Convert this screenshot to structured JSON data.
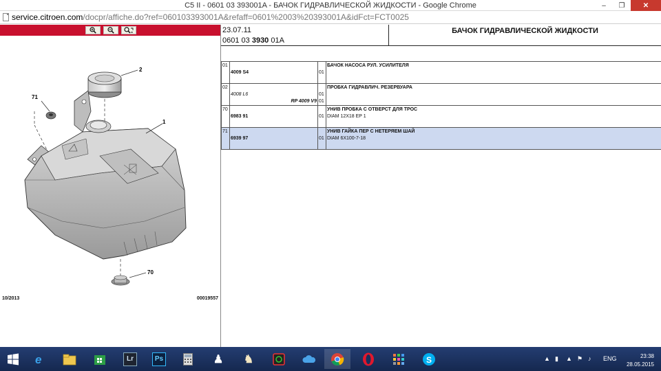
{
  "window": {
    "title": "C5 II - 0601 03 393001A - БАЧОК ГИДРАВЛИЧЕСКОЙ ЖИДКОСТИ - Google Chrome",
    "url_host": "service.citroen.com",
    "url_path": "/docpr/affiche.do?ref=060103393001A&refaff=0601%2003%20393001A&idFct=FCT0025"
  },
  "left_panel": {
    "toolbar": {
      "zoom_in_icon": "zoom-in",
      "zoom_out_icon": "zoom-out",
      "zoom_fit_icon": "zoom-fit",
      "bar_color": "#c8102e"
    },
    "callouts": {
      "c1": "1",
      "c2": "2",
      "c70": "70",
      "c71": "71"
    },
    "footer_date": "10/2013",
    "footer_code": "00019557"
  },
  "header": {
    "date": "23.07.11",
    "ref_prefix": "0601 03",
    "ref_bold": "3930",
    "ref_suffix": "01A",
    "title": "БАЧОК ГИДРАВЛИЧЕСКОЙ ЖИДКОСТИ"
  },
  "parts": [
    {
      "item": "01",
      "ref": "4009 S4",
      "ref_italic": false,
      "ref2": "",
      "qty1": "01",
      "qty2": "",
      "desc": "БАЧОК НАСОСА РУЛ. УСИЛИТЕЛЯ",
      "desc2": "",
      "highlight": false
    },
    {
      "item": "02",
      "ref": "4008 L6",
      "ref_italic": true,
      "ref2": "RP 4009 V9",
      "qty1": "01",
      "qty2": "01",
      "desc": "ПРОБКА ГИДРАВЛИЧ. РЕЗЕРВУАРА",
      "desc2": "",
      "highlight": false
    },
    {
      "item": "70",
      "ref": "6983 91",
      "ref_italic": false,
      "ref2": "",
      "qty1": "01",
      "qty2": "",
      "desc": "УНИВ ПРОБКА С ОТВЕРСТ ДЛЯ ТРОС",
      "desc2": "DIAM 12X18 EP 1",
      "highlight": false
    },
    {
      "item": "71",
      "ref": "6939 97",
      "ref_italic": false,
      "ref2": "",
      "qty1": "01",
      "qty2": "",
      "desc": "УНИВ ГАЙКА ПЕР С НЕТЕРЯЕМ ШАЙ",
      "desc2": "DIAM 6X100-7-18",
      "highlight": true
    }
  ],
  "taskbar": {
    "apps": [
      "start-icon",
      "internet-explorer-icon",
      "file-explorer-icon",
      "store-icon",
      "lightroom-icon",
      "photoshop-icon",
      "calculator-icon",
      "chess-icon",
      "game-icon",
      "camera-icon",
      "onedrive-icon",
      "chrome-icon",
      "opera-icon",
      "apps-icon",
      "skype-icon"
    ],
    "lr_label": "Lr",
    "ps_label": "Ps",
    "lang": "ENG",
    "time": "23:38",
    "date": "28.05.2015"
  }
}
